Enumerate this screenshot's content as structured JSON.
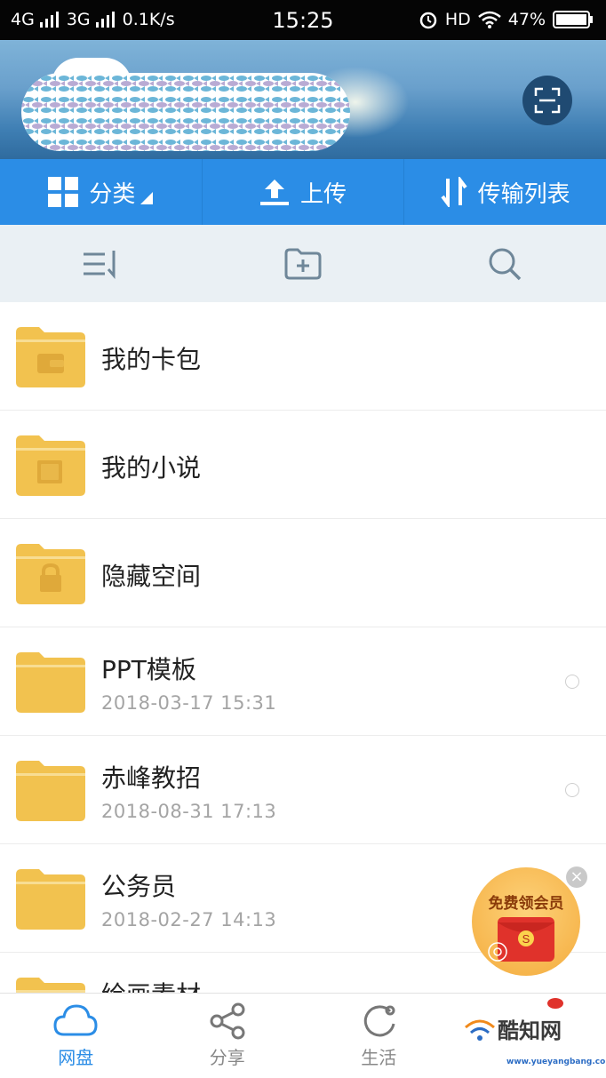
{
  "status_bar": {
    "network1": "4G",
    "network2": "3G",
    "speed": "0.1K/s",
    "time": "15:25",
    "hd": "HD",
    "battery": "47%"
  },
  "actions": [
    {
      "label": "分类",
      "icon": "grid-icon"
    },
    {
      "label": "上传",
      "icon": "upload-icon"
    },
    {
      "label": "传输列表",
      "icon": "transfer-icon"
    }
  ],
  "files": [
    {
      "name": "我的卡包",
      "icon": "wallet-icon"
    },
    {
      "name": "我的小说",
      "icon": "book-icon"
    },
    {
      "name": "隐藏空间",
      "icon": "lock-icon"
    },
    {
      "name": "PPT模板",
      "date": "2018-03-17  15:31"
    },
    {
      "name": "赤峰教招",
      "date": "2018-08-31  17:13"
    },
    {
      "name": "公务员",
      "date": "2018-02-27  14:13"
    },
    {
      "name": "绘画素材"
    }
  ],
  "promo": {
    "label": "免费领会员"
  },
  "tabs": [
    {
      "label": "网盘",
      "icon": "cloud-icon",
      "active": true
    },
    {
      "label": "分享",
      "icon": "share-icon"
    },
    {
      "label": "生活",
      "icon": "life-icon"
    }
  ],
  "watermark": {
    "text": "酷知网",
    "sub": "www.yueyangbang.com"
  },
  "colors": {
    "accent": "#2b8de6",
    "folder": "#f2c24f"
  }
}
